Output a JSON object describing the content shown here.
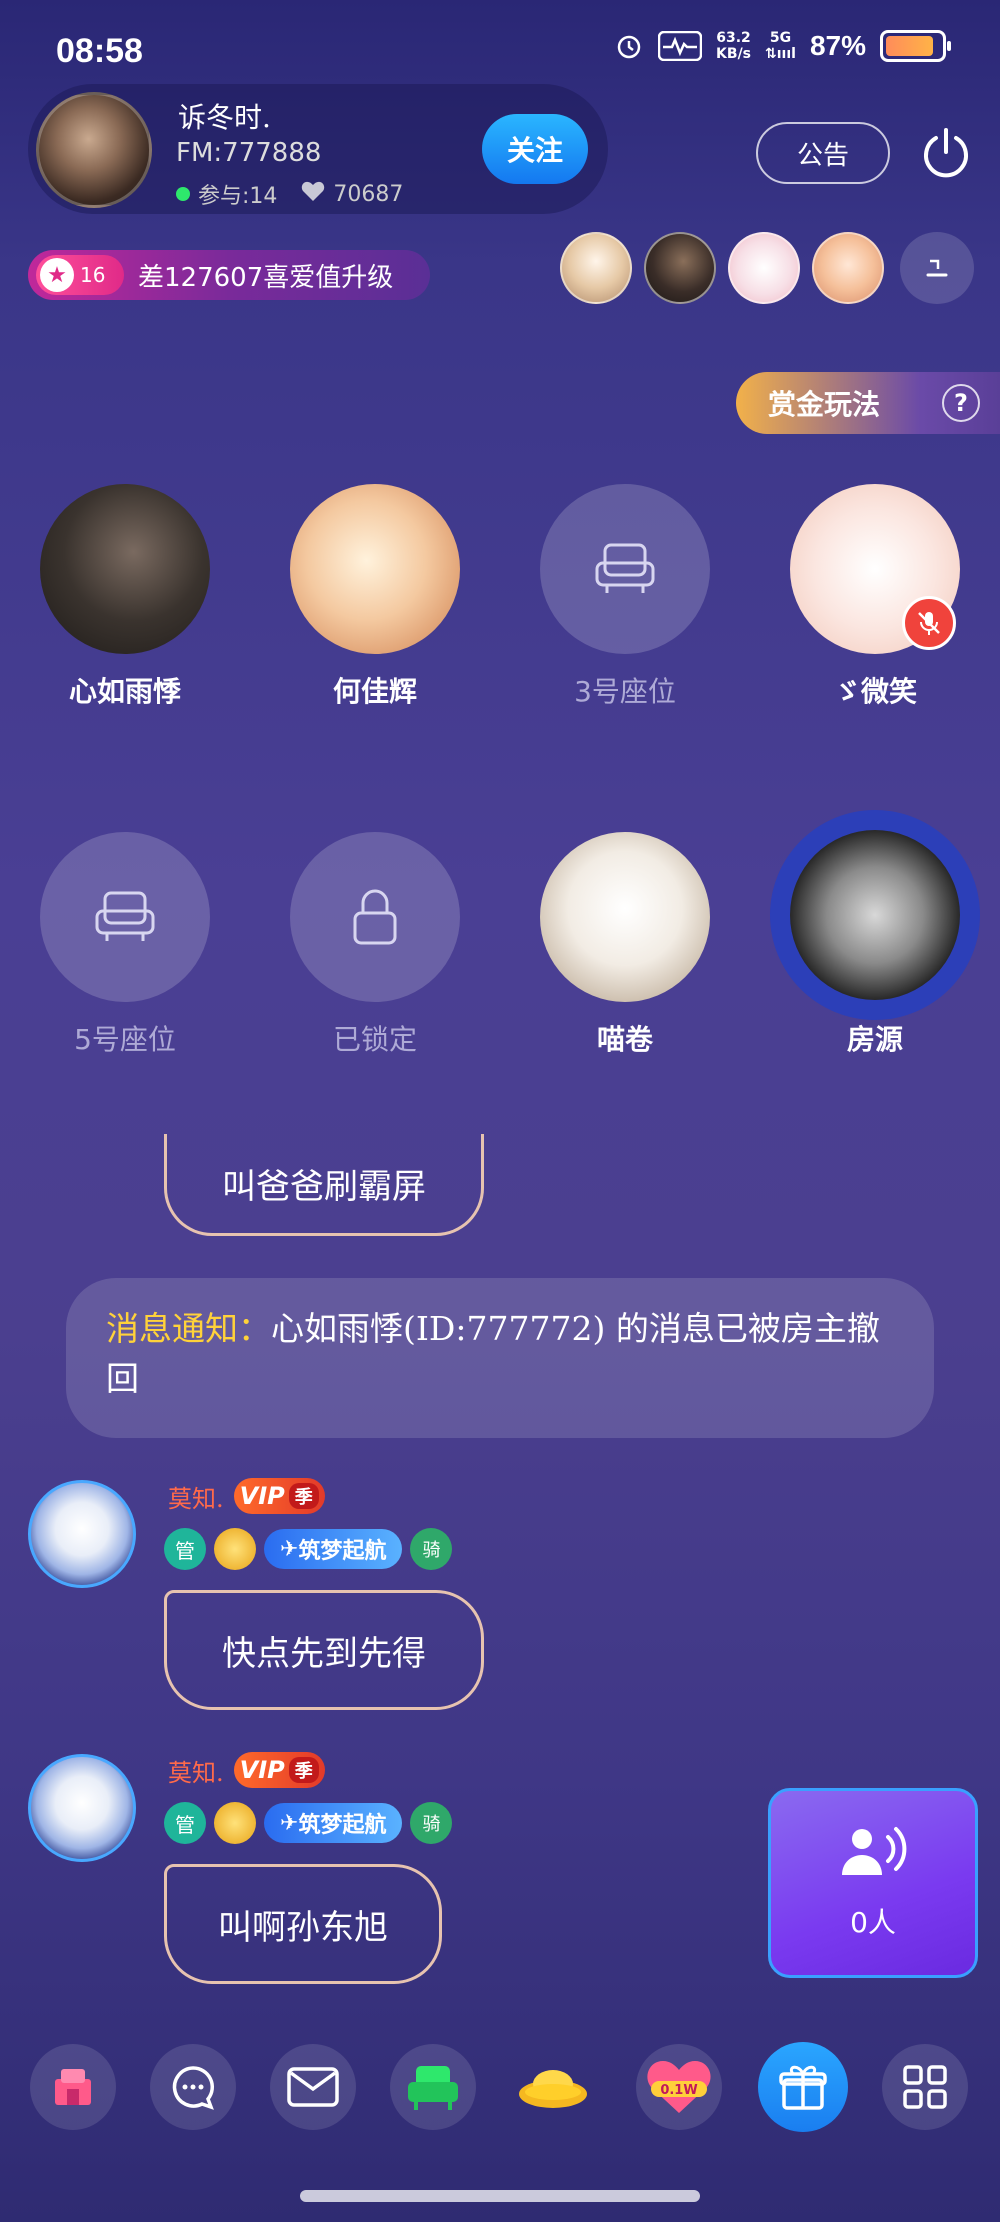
{
  "status": {
    "time": "08:58",
    "net_speed_value": "63.2",
    "net_speed_unit": "KB/s",
    "net_type": "5G",
    "battery": "87%"
  },
  "host": {
    "name": "诉冬时.",
    "fm": "FM:777888",
    "participants": "参与:14",
    "likes": "70687",
    "follow": "关注"
  },
  "header": {
    "notice": "公告",
    "level": "16",
    "level_text": "差127607喜爱值升级",
    "more_icon": "chevron-down-icon"
  },
  "bounty": {
    "label": "赏金玩法",
    "help": "?"
  },
  "seats": [
    {
      "label": "心如雨悸",
      "state": "occupied"
    },
    {
      "label": "何佳辉",
      "state": "occupied"
    },
    {
      "label": "3号座位",
      "state": "empty"
    },
    {
      "label": "ゞ微笑",
      "state": "muted"
    },
    {
      "label": "5号座位",
      "state": "empty"
    },
    {
      "label": "已锁定",
      "state": "locked"
    },
    {
      "label": "喵卷",
      "state": "occupied"
    },
    {
      "label": "房源",
      "state": "speaking"
    }
  ],
  "chat": {
    "partial_bubble": "叫爸爸刷霸屏",
    "system_prefix": "消息通知：",
    "system_text": "心如雨悸(ID:777772) 的消息已被房主撤回",
    "messages": [
      {
        "name": "莫知.",
        "vip": "VIP",
        "season": "季",
        "admin": "管",
        "title": "筑梦起航",
        "ride": "骑",
        "text": "快点先到先得"
      },
      {
        "name": "莫知.",
        "vip": "VIP",
        "season": "季",
        "admin": "管",
        "title": "筑梦起航",
        "ride": "骑",
        "text": "叫啊孙东旭"
      }
    ]
  },
  "online": {
    "count": "0人"
  },
  "toolbar": {
    "heart_label": "0.1W"
  }
}
